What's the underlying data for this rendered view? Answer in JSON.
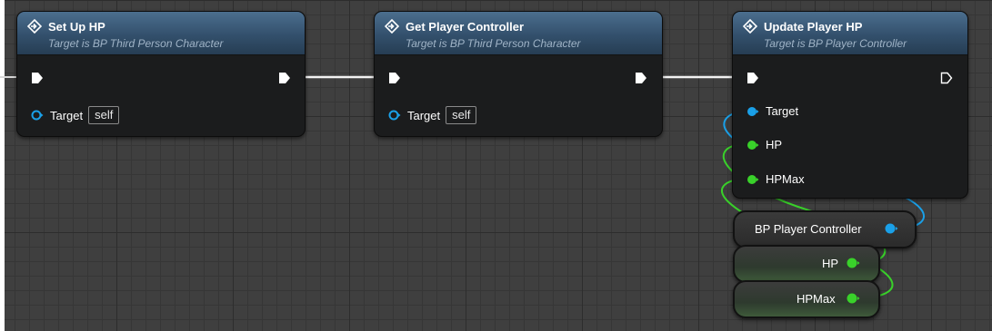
{
  "colors": {
    "object_pin": "#1aa0e8",
    "float_pin": "#39d12a",
    "exec_pin": "#ffffff",
    "header": "#33506c"
  },
  "nodes": {
    "setup_hp": {
      "title": "Set Up HP",
      "subtitle": "Target is BP Third Person Character",
      "target_label": "Target",
      "target_value": "self",
      "icon": "function-icon"
    },
    "get_player_controller": {
      "title": "Get Player Controller",
      "subtitle": "Target is BP Third Person Character",
      "target_label": "Target",
      "target_value": "self",
      "icon": "function-icon"
    },
    "update_player_hp": {
      "title": "Update Player HP",
      "subtitle": "Target is BP Player Controller",
      "pins": [
        "Target",
        "HP",
        "HPMax"
      ],
      "icon": "function-icon"
    }
  },
  "variables": [
    {
      "label": "BP Player Controller",
      "type": "object"
    },
    {
      "label": "HP",
      "type": "float"
    },
    {
      "label": "HPMax",
      "type": "float"
    }
  ]
}
